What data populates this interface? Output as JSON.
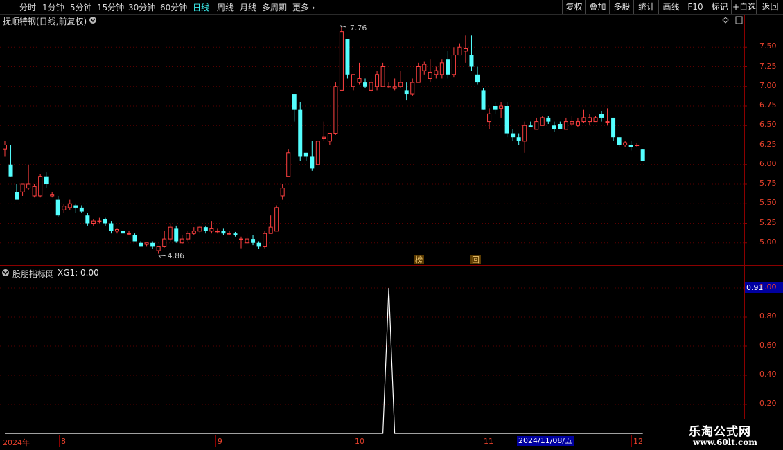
{
  "toolbar": {
    "periods": [
      {
        "label": "分时",
        "name": "period-intraday"
      },
      {
        "label": "1分钟",
        "name": "period-1min"
      },
      {
        "label": "5分钟",
        "name": "period-5min"
      },
      {
        "label": "15分钟",
        "name": "period-15min"
      },
      {
        "label": "30分钟",
        "name": "period-30min"
      },
      {
        "label": "60分钟",
        "name": "period-60min"
      },
      {
        "label": "日线",
        "name": "period-daily",
        "active": true
      },
      {
        "label": "周线",
        "name": "period-weekly"
      },
      {
        "label": "月线",
        "name": "period-monthly"
      },
      {
        "label": "多周期",
        "name": "period-multi"
      },
      {
        "label": "更多",
        "name": "period-more"
      }
    ],
    "more_arrow": "›",
    "buttons": [
      {
        "label": "复权",
        "name": "adjust-button"
      },
      {
        "label": "叠加",
        "name": "overlay-button"
      },
      {
        "label": "多股",
        "name": "multi-stock-button"
      },
      {
        "label": "统计",
        "name": "statistics-button"
      },
      {
        "label": "画线",
        "name": "draw-line-button"
      },
      {
        "label": "F10",
        "name": "f10-button"
      },
      {
        "label": "标记",
        "name": "mark-button"
      },
      {
        "label": "+自选",
        "name": "add-watchlist-button"
      },
      {
        "label": "返回",
        "name": "back-button"
      }
    ]
  },
  "main_panel": {
    "title": "抚顺特钢(日线,前复权)",
    "price_axis_ticks": [
      "7.50",
      "7.25",
      "7.00",
      "6.75",
      "6.50",
      "6.25",
      "6.00",
      "5.75",
      "5.50",
      "5.25",
      "5.00"
    ],
    "high_marker": "7.76",
    "low_marker": "4.86",
    "event_markers": [
      "榜",
      "回"
    ]
  },
  "indicator_panel": {
    "title": "股朋指标网",
    "indicator_label": "XG1: 0.00",
    "axis_ticks": [
      "1.00",
      "0.80",
      "0.60",
      "0.40",
      "0.20"
    ],
    "current_value": "0.91"
  },
  "time_axis": {
    "labels": [
      "2024年",
      "8",
      "9",
      "10",
      "11",
      "12"
    ],
    "cursor_label": "2024/11/08/五"
  },
  "watermark": {
    "line1": "乐淘公式网",
    "line2": "www.60lt.com"
  },
  "colors": {
    "up": "#ff4040",
    "down": "#54ffff",
    "grid": "#5a0000",
    "axis_text": "#e8412c",
    "label_text": "#c8c8c8"
  },
  "chart_data": {
    "type": "candlestick",
    "ylim": [
      4.75,
      7.75
    ],
    "ohlc": [
      [
        6.2,
        6.3,
        6.1,
        6.25
      ],
      [
        6.0,
        6.25,
        5.85,
        5.85
      ],
      [
        5.65,
        5.75,
        5.6,
        5.55
      ],
      [
        5.65,
        5.75,
        5.6,
        5.75
      ],
      [
        5.7,
        6.0,
        5.68,
        5.75
      ],
      [
        5.6,
        5.75,
        5.58,
        5.72
      ],
      [
        5.6,
        5.88,
        5.58,
        5.85
      ],
      [
        5.85,
        5.9,
        5.7,
        5.75
      ],
      [
        5.6,
        5.65,
        5.58,
        5.62
      ],
      [
        5.55,
        5.6,
        5.33,
        5.35
      ],
      [
        5.42,
        5.5,
        5.38,
        5.47
      ],
      [
        5.45,
        5.55,
        5.42,
        5.5
      ],
      [
        5.48,
        5.5,
        5.38,
        5.45
      ],
      [
        5.45,
        5.48,
        5.38,
        5.4
      ],
      [
        5.35,
        5.38,
        5.22,
        5.25
      ],
      [
        5.25,
        5.3,
        5.22,
        5.28
      ],
      [
        5.28,
        5.32,
        5.25,
        5.28
      ],
      [
        5.3,
        5.32,
        5.22,
        5.25
      ],
      [
        5.25,
        5.28,
        5.12,
        5.15
      ],
      [
        5.15,
        5.18,
        5.12,
        5.17
      ],
      [
        5.15,
        5.2,
        5.1,
        5.12
      ],
      [
        5.12,
        5.15,
        5.1,
        5.12
      ],
      [
        5.1,
        5.12,
        5.02,
        5.02
      ],
      [
        5.0,
        5.02,
        4.95,
        4.95
      ],
      [
        4.98,
        5.0,
        4.95,
        5.0
      ],
      [
        5.0,
        5.02,
        4.92,
        4.95
      ],
      [
        4.9,
        4.96,
        4.86,
        4.95
      ],
      [
        4.95,
        5.15,
        4.94,
        5.05
      ],
      [
        5.05,
        5.25,
        5.02,
        5.2
      ],
      [
        5.18,
        5.22,
        5.0,
        5.02
      ],
      [
        5.0,
        5.1,
        4.98,
        5.05
      ],
      [
        5.05,
        5.15,
        5.02,
        5.12
      ],
      [
        5.12,
        5.2,
        5.1,
        5.15
      ],
      [
        5.15,
        5.22,
        5.12,
        5.2
      ],
      [
        5.2,
        5.22,
        5.12,
        5.15
      ],
      [
        5.15,
        5.28,
        5.12,
        5.18
      ],
      [
        5.15,
        5.18,
        5.12,
        5.15
      ],
      [
        5.15,
        5.18,
        5.1,
        5.12
      ],
      [
        5.12,
        5.15,
        5.1,
        5.12
      ],
      [
        5.12,
        5.14,
        5.08,
        5.1
      ],
      [
        5.05,
        5.08,
        4.93,
        5.05
      ],
      [
        5.0,
        5.12,
        4.98,
        5.05
      ],
      [
        5.05,
        5.1,
        4.97,
        5.0
      ],
      [
        5.0,
        5.02,
        4.92,
        4.95
      ],
      [
        4.95,
        5.15,
        4.93,
        5.12
      ],
      [
        5.12,
        5.35,
        5.12,
        5.2
      ],
      [
        5.15,
        5.48,
        5.15,
        5.45
      ],
      [
        5.6,
        5.75,
        5.55,
        5.7
      ],
      [
        5.85,
        6.2,
        5.85,
        6.15
      ],
      [
        6.9,
        6.9,
        6.55,
        6.7
      ],
      [
        6.7,
        6.8,
        6.05,
        6.1
      ],
      [
        6.15,
        6.15,
        6.05,
        6.1
      ],
      [
        6.1,
        6.3,
        5.92,
        5.95
      ],
      [
        6.0,
        6.3,
        6.0,
        6.3
      ],
      [
        6.33,
        6.55,
        6.3,
        6.35
      ],
      [
        6.3,
        6.4,
        6.25,
        6.4
      ],
      [
        6.4,
        7.05,
        6.38,
        7.0
      ],
      [
        6.95,
        7.76,
        6.95,
        7.7
      ],
      [
        7.6,
        7.6,
        7.1,
        7.15
      ],
      [
        7.0,
        7.1,
        6.95,
        7.15
      ],
      [
        7.05,
        7.3,
        7.02,
        7.1
      ],
      [
        7.05,
        7.1,
        6.98,
        7.0
      ],
      [
        6.95,
        7.1,
        6.92,
        7.05
      ],
      [
        7.0,
        7.2,
        6.95,
        7.15
      ],
      [
        7.0,
        7.3,
        7.0,
        7.25
      ],
      [
        7.0,
        7.05,
        6.98,
        7.0
      ],
      [
        6.98,
        7.1,
        6.95,
        7.0
      ],
      [
        7.0,
        7.2,
        6.98,
        7.05
      ],
      [
        6.95,
        7.05,
        6.82,
        6.9
      ],
      [
        6.9,
        7.1,
        6.88,
        7.05
      ],
      [
        7.05,
        7.3,
        7.05,
        7.25
      ],
      [
        7.2,
        7.32,
        7.15,
        7.28
      ],
      [
        7.1,
        7.35,
        7.05,
        7.18
      ],
      [
        7.15,
        7.25,
        7.1,
        7.2
      ],
      [
        7.15,
        7.35,
        7.1,
        7.3
      ],
      [
        7.35,
        7.45,
        7.1,
        7.15
      ],
      [
        7.15,
        7.5,
        7.12,
        7.4
      ],
      [
        7.4,
        7.55,
        7.4,
        7.5
      ],
      [
        7.45,
        7.65,
        7.3,
        7.48
      ],
      [
        7.4,
        7.65,
        7.2,
        7.25
      ],
      [
        7.15,
        7.25,
        7.02,
        7.05
      ],
      [
        6.95,
        6.98,
        6.7,
        6.7
      ],
      [
        6.55,
        6.72,
        6.45,
        6.65
      ],
      [
        6.75,
        6.8,
        6.65,
        6.7
      ],
      [
        6.72,
        6.8,
        6.6,
        6.75
      ],
      [
        6.75,
        6.8,
        6.35,
        6.4
      ],
      [
        6.4,
        6.45,
        6.3,
        6.35
      ],
      [
        6.35,
        6.4,
        6.25,
        6.3
      ],
      [
        6.3,
        6.55,
        6.15,
        6.5
      ],
      [
        6.5,
        6.55,
        6.48,
        6.48
      ],
      [
        6.45,
        6.6,
        6.45,
        6.55
      ],
      [
        6.5,
        6.62,
        6.5,
        6.6
      ],
      [
        6.6,
        6.62,
        6.52,
        6.55
      ],
      [
        6.5,
        6.55,
        6.42,
        6.45
      ],
      [
        6.52,
        6.55,
        6.45,
        6.45
      ],
      [
        6.45,
        6.6,
        6.45,
        6.55
      ],
      [
        6.52,
        6.62,
        6.5,
        6.55
      ],
      [
        6.5,
        6.6,
        6.48,
        6.55
      ],
      [
        6.55,
        6.7,
        6.53,
        6.6
      ],
      [
        6.55,
        6.65,
        6.5,
        6.6
      ],
      [
        6.55,
        6.62,
        6.55,
        6.6
      ],
      [
        6.65,
        6.68,
        6.55,
        6.6
      ],
      [
        6.55,
        6.72,
        6.5,
        6.55
      ],
      [
        6.6,
        6.6,
        6.3,
        6.35
      ],
      [
        6.35,
        6.35,
        6.22,
        6.25
      ],
      [
        6.25,
        6.3,
        6.22,
        6.28
      ],
      [
        6.25,
        6.3,
        6.18,
        6.22
      ],
      [
        6.25,
        6.28,
        6.22,
        6.25
      ],
      [
        6.2,
        6.2,
        6.05,
        6.05
      ]
    ],
    "signal": {
      "ylim": [
        0,
        1.05
      ],
      "values_by_index": {
        "65": 1.0
      },
      "baseline": 0
    }
  }
}
